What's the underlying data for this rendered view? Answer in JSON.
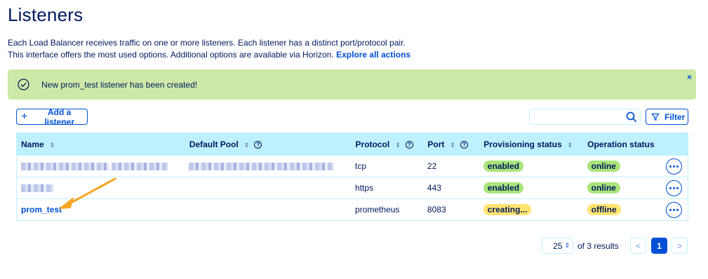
{
  "header": {
    "title": "Listeners",
    "description_line1": "Each Load Balancer receives traffic on one or more listeners. Each listener has a distinct port/protocol pair.",
    "description_line2": "This interface offers the most used options. Additional options are available via Horizon.",
    "explore_link": "Explore all actions"
  },
  "alert": {
    "message": "New prom_test listener has been created!",
    "close": "×",
    "color": "#cde9a7"
  },
  "toolbar": {
    "add_label": "Add a listener",
    "search_value": "",
    "filter_label": "Filter"
  },
  "table": {
    "columns": {
      "name": "Name",
      "pool": "Default Pool",
      "protocol": "Protocol",
      "port": "Port",
      "provisioning": "Provisioning status",
      "operation": "Operation status"
    },
    "rows": [
      {
        "protocol": "tcp",
        "port": "22",
        "provisioning": "enabled",
        "operation": "online"
      },
      {
        "protocol": "https",
        "port": "443",
        "provisioning": "enabled",
        "operation": "online"
      },
      {
        "name": "prom_test",
        "protocol": "prometheus",
        "port": "8083",
        "provisioning": "creating...",
        "operation": "offline"
      }
    ]
  },
  "pagination": {
    "page_size": "25",
    "results": "of 3 results",
    "prev": "<",
    "current": "1",
    "next": ">"
  },
  "colors": {
    "primary": "#0050d7",
    "text": "#00185e",
    "header_bg": "#bef1ff",
    "badge_green": "#a9e57a",
    "badge_yellow": "#ffe570",
    "arrow": "#f5a623"
  }
}
